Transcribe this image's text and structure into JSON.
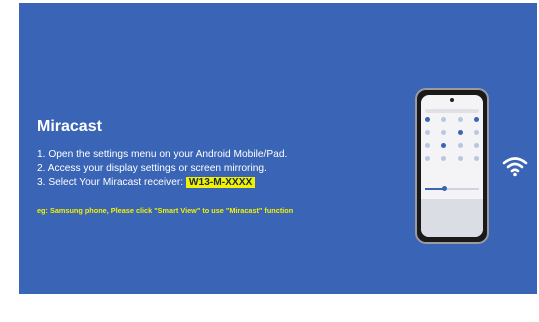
{
  "title": "Miracast",
  "steps": {
    "step1": "1. Open the settings menu on your Android Mobile/Pad.",
    "step2": "2. Access your display settings or screen mirroring.",
    "step3_prefix": "3. Select Your Miracast receiver: ",
    "receiver_name": "W13-M-XXXX"
  },
  "note": "eg: Samsung phone, Please click \"Smart View\" to use  \"Miracast\"  function",
  "colors": {
    "background": "#3a64b5",
    "highlight": "#f2f200",
    "text": "#ffffff"
  },
  "icons": {
    "phone": "smartphone-icon",
    "wifi": "wifi-icon"
  }
}
